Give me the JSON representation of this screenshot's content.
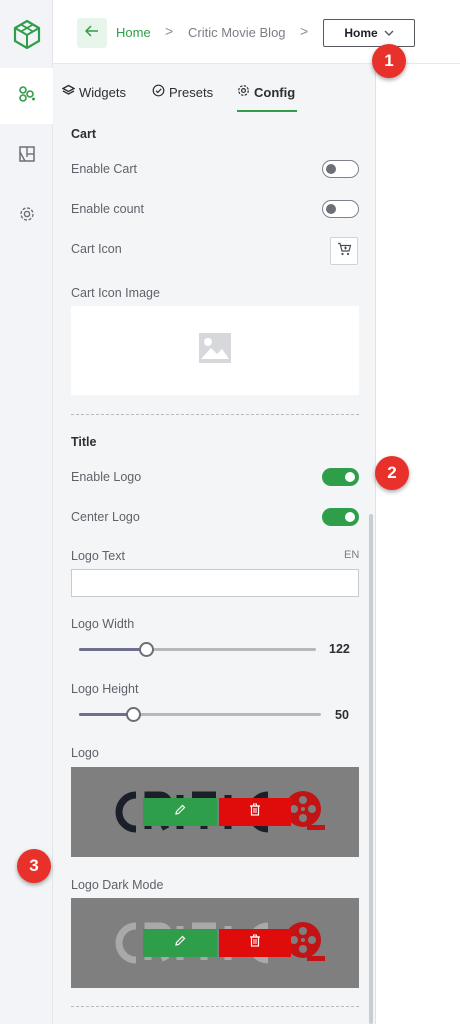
{
  "rail": {
    "logo_icon": "cube-logo-icon",
    "items": [
      {
        "icon": "widgets-icon",
        "active": true
      },
      {
        "icon": "layout-icon",
        "active": false
      },
      {
        "icon": "gear-icon",
        "active": false
      }
    ]
  },
  "header": {
    "back_icon": "arrow-left-icon",
    "breadcrumb_home": "Home",
    "breadcrumb_sep": ">",
    "breadcrumb_blog": "Critic Movie Blog",
    "page_select_value": "Home"
  },
  "tabs": [
    {
      "label": "Widgets",
      "icon": "layers-icon"
    },
    {
      "label": "Presets",
      "icon": "check-circle-icon"
    },
    {
      "label": "Config",
      "icon": "gear-icon",
      "active": true
    }
  ],
  "cart": {
    "title": "Cart",
    "enable_cart_label": "Enable Cart",
    "enable_cart": false,
    "enable_count_label": "Enable count",
    "enable_count": false,
    "cart_icon_label": "Cart Icon",
    "cart_icon_image_label": "Cart Icon Image"
  },
  "title_section": {
    "title": "Title",
    "enable_logo_label": "Enable Logo",
    "enable_logo": true,
    "center_logo_label": "Center Logo",
    "center_logo": true,
    "logo_text_label": "Logo Text",
    "language": "EN",
    "logo_text_value": "",
    "logo_width_label": "Logo Width",
    "logo_width": "122",
    "logo_height_label": "Logo Height",
    "logo_height": "50",
    "logo_label": "Logo",
    "logo_dark_mode_label": "Logo Dark Mode"
  },
  "badges": [
    "1",
    "2",
    "3"
  ],
  "colors": {
    "accent": "#2e9e4a",
    "danger": "#e00b0b",
    "badge": "#e8312a"
  }
}
